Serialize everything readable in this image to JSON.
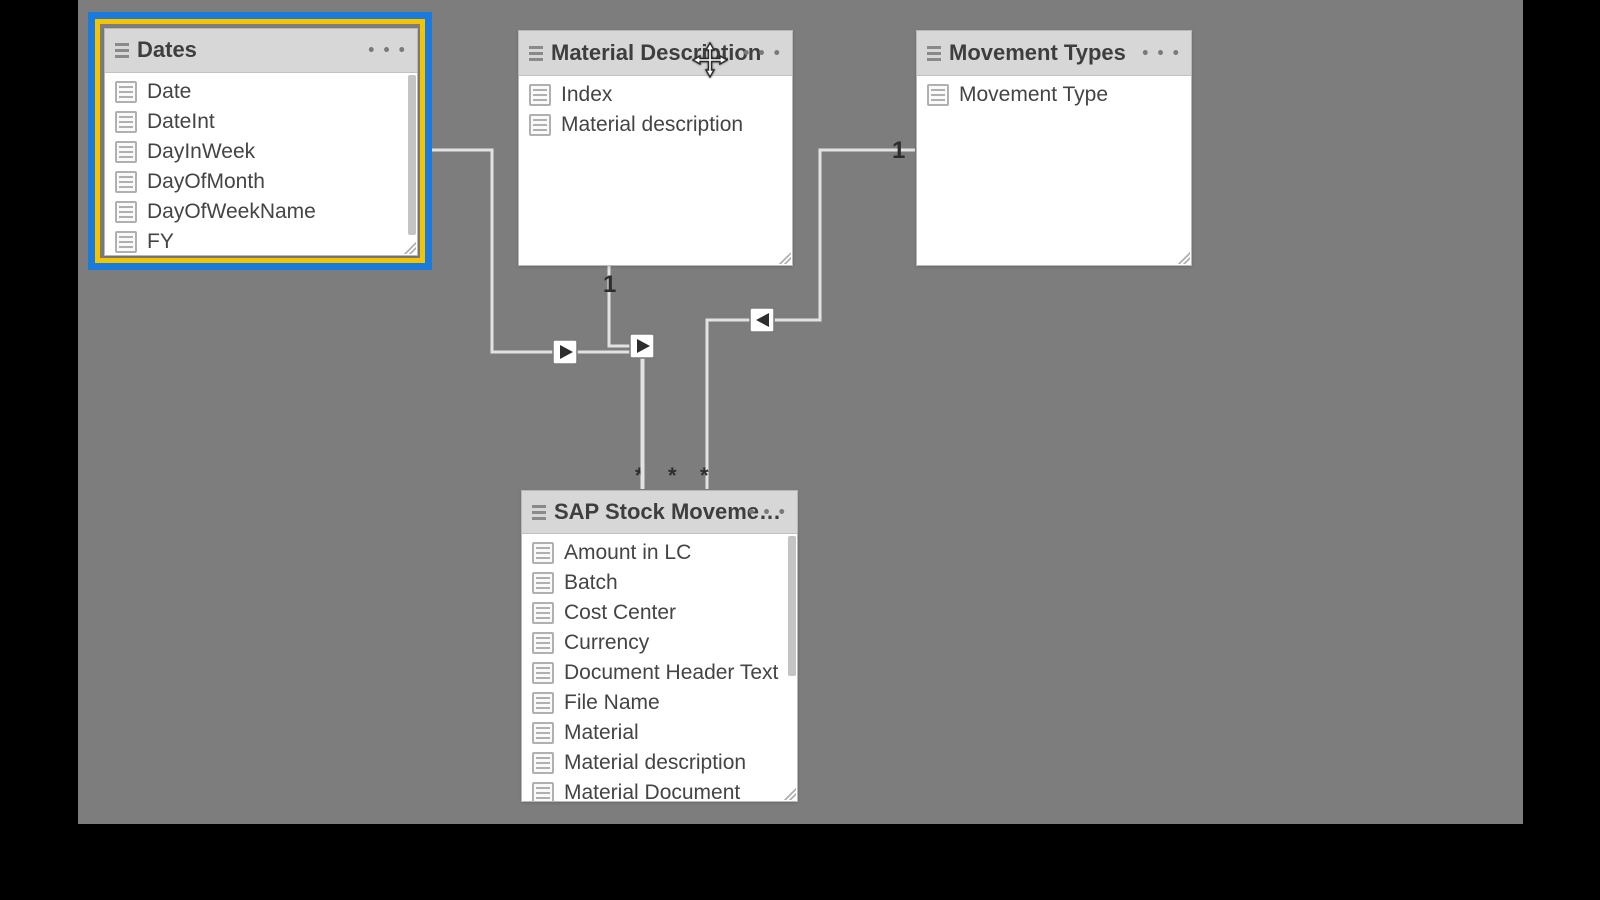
{
  "tables": {
    "dates": {
      "title": "Dates",
      "fields": [
        "Date",
        "DateInt",
        "DayInWeek",
        "DayOfMonth",
        "DayOfWeekName",
        "FY"
      ]
    },
    "matdesc": {
      "title": "Material Description",
      "fields": [
        "Index",
        "Material description"
      ]
    },
    "movtype": {
      "title": "Movement Types",
      "fields": [
        "Movement Type"
      ]
    },
    "sap": {
      "title": "SAP Stock Movements",
      "fields": [
        "Amount in LC",
        "Batch",
        "Cost Center",
        "Currency",
        "Document Header Text",
        "File Name",
        "Material",
        "Material description",
        "Material Document"
      ]
    }
  },
  "relations": {
    "mid_one": "1",
    "right_one": "1",
    "star_a": "*",
    "star_b": "*",
    "star_c": "*"
  }
}
